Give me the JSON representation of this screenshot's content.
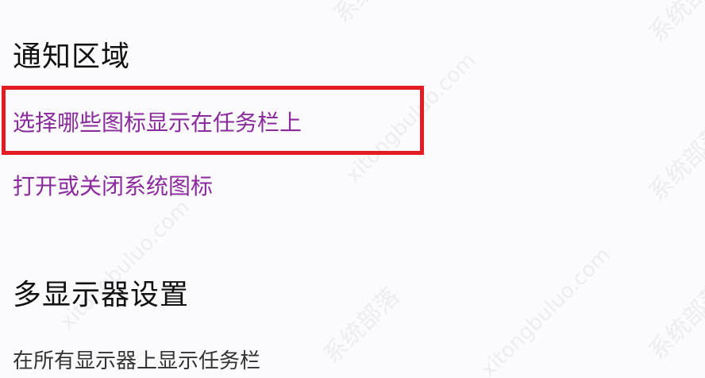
{
  "notification_area": {
    "title": "通知区域",
    "choose_icons_link": "选择哪些图标显示在任务栏上",
    "toggle_system_icons_link": "打开或关闭系统图标"
  },
  "multi_display": {
    "title": "多显示器设置",
    "show_taskbar_all_label": "在所有显示器上显示任务栏"
  },
  "watermark": {
    "text_cn": "系统部落",
    "text_url": "xitongbuluo.com"
  },
  "colors": {
    "background": "#fbfbfd",
    "link": "#8a2a9c",
    "highlight": "#e31c23",
    "title": "#111111"
  }
}
